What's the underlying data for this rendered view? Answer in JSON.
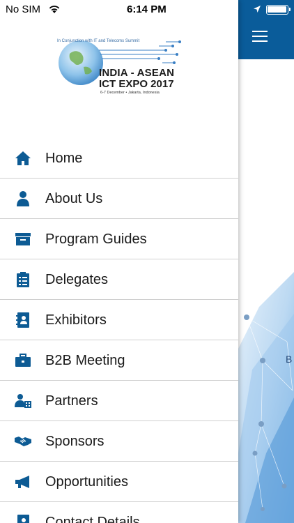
{
  "status_bar": {
    "carrier": "No SIM",
    "time": "6:14 PM"
  },
  "logo": {
    "curved_text": "In Conjunction with IT and Telecoms Summit",
    "title_line1": "INDIA - ASEAN",
    "title_line2": "ICT EXPO 2017",
    "subtitle": "6-7 December • Jakarta, Indonesia"
  },
  "menu": {
    "items": [
      {
        "label": "Home",
        "icon": "home-icon"
      },
      {
        "label": "About Us",
        "icon": "person-icon"
      },
      {
        "label": "Program Guides",
        "icon": "archive-box-icon"
      },
      {
        "label": "Delegates",
        "icon": "clipboard-list-icon"
      },
      {
        "label": "Exhibitors",
        "icon": "contact-book-icon"
      },
      {
        "label": "B2B Meeting",
        "icon": "briefcase-icon"
      },
      {
        "label": "Partners",
        "icon": "user-building-icon"
      },
      {
        "label": "Sponsors",
        "icon": "handshake-icon"
      },
      {
        "label": "Opportunities",
        "icon": "megaphone-icon"
      },
      {
        "label": "Contact Details",
        "icon": "contact-card-icon"
      }
    ]
  },
  "main": {
    "peek_text": "B"
  },
  "colors": {
    "header_blue": "#0a5c9a",
    "icon_blue": "#0d5b94"
  }
}
